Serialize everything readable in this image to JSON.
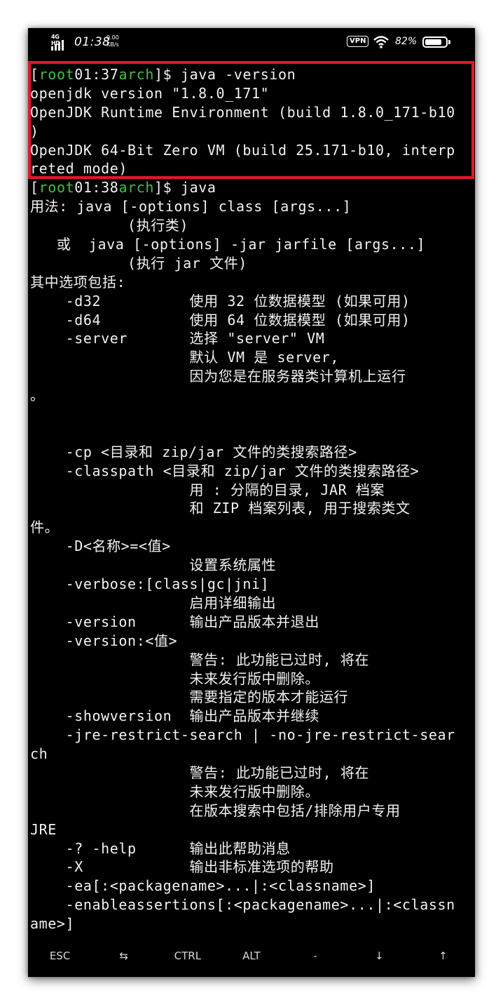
{
  "status_bar": {
    "network": "4G HD",
    "time": "01:38",
    "speed_value": "0.00",
    "speed_unit": "KB/s",
    "vpn": "VPN",
    "battery_percent": "82%",
    "battery_level": 0.82
  },
  "highlight_color": "#e01828",
  "prompt_color": "#40c040",
  "terminal_lines": [
    [
      {
        "t": "["
      },
      {
        "t": "root",
        "c": "g"
      },
      {
        "t": "01:37"
      },
      {
        "t": "arch",
        "c": "g"
      },
      {
        "t": "]$ java -version"
      }
    ],
    [
      {
        "t": "openjdk version \"1.8.0_171\""
      }
    ],
    [
      {
        "t": "OpenJDK Runtime Environment (build 1.8.0_171-b10"
      }
    ],
    [
      {
        "t": ")"
      }
    ],
    [
      {
        "t": "OpenJDK 64-Bit Zero VM (build 25.171-b10, interp"
      }
    ],
    [
      {
        "t": "reted mode)"
      }
    ],
    [
      {
        "t": "["
      },
      {
        "t": "root",
        "c": "g"
      },
      {
        "t": "01:38"
      },
      {
        "t": "arch",
        "c": "g"
      },
      {
        "t": "]$ java"
      }
    ],
    [
      {
        "t": "用法: java [-options] class [args...]"
      }
    ],
    [
      {
        "t": "           (执行类)"
      }
    ],
    [
      {
        "t": "   或  java [-options] -jar jarfile [args...]"
      }
    ],
    [
      {
        "t": "           (执行 jar 文件)"
      }
    ],
    [
      {
        "t": "其中选项包括:"
      }
    ],
    [
      {
        "t": "    -d32          使用 32 位数据模型 (如果可用)"
      }
    ],
    [
      {
        "t": "    -d64          使用 64 位数据模型 (如果可用)"
      }
    ],
    [
      {
        "t": "    -server       选择 \"server\" VM"
      }
    ],
    [
      {
        "t": "                  默认 VM 是 server,"
      }
    ],
    [
      {
        "t": "                  因为您是在服务器类计算机上运行"
      }
    ],
    [
      {
        "t": "。"
      }
    ],
    [
      {
        "t": ""
      }
    ],
    [
      {
        "t": ""
      }
    ],
    [
      {
        "t": "    -cp <目录和 zip/jar 文件的类搜索路径>"
      }
    ],
    [
      {
        "t": "    -classpath <目录和 zip/jar 文件的类搜索路径>"
      }
    ],
    [
      {
        "t": "                  用 : 分隔的目录, JAR 档案"
      }
    ],
    [
      {
        "t": "                  和 ZIP 档案列表, 用于搜索类文"
      }
    ],
    [
      {
        "t": "件。"
      }
    ],
    [
      {
        "t": "    -D<名称>=<值>"
      }
    ],
    [
      {
        "t": "                  设置系统属性"
      }
    ],
    [
      {
        "t": "    -verbose:[class|gc|jni]"
      }
    ],
    [
      {
        "t": "                  启用详细输出"
      }
    ],
    [
      {
        "t": "    -version      输出产品版本并退出"
      }
    ],
    [
      {
        "t": "    -version:<值>"
      }
    ],
    [
      {
        "t": "                  警告: 此功能已过时, 将在"
      }
    ],
    [
      {
        "t": "                  未来发行版中删除。"
      }
    ],
    [
      {
        "t": "                  需要指定的版本才能运行"
      }
    ],
    [
      {
        "t": "    -showversion  输出产品版本并继续"
      }
    ],
    [
      {
        "t": "    -jre-restrict-search | -no-jre-restrict-sear"
      }
    ],
    [
      {
        "t": "ch"
      }
    ],
    [
      {
        "t": "                  警告: 此功能已过时, 将在"
      }
    ],
    [
      {
        "t": "                  未来发行版中删除。"
      }
    ],
    [
      {
        "t": "                  在版本搜索中包括/排除用户专用"
      }
    ],
    [
      {
        "t": "JRE"
      }
    ],
    [
      {
        "t": "    -? -help      输出此帮助消息"
      }
    ],
    [
      {
        "t": "    -X            输出非标准选项的帮助"
      }
    ],
    [
      {
        "t": "    -ea[:<packagename>...|:<classname>]"
      }
    ],
    [
      {
        "t": "    -enableassertions[:<packagename>...|:<classn"
      }
    ],
    [
      {
        "t": "ame>]"
      }
    ]
  ],
  "extra_keys": [
    {
      "label": "ESC",
      "icon": "esc-key"
    },
    {
      "label": "⇆",
      "icon": "tab-icon"
    },
    {
      "label": "CTRL",
      "icon": "ctrl-key"
    },
    {
      "label": "ALT",
      "icon": "alt-key"
    },
    {
      "label": "-",
      "icon": "dash-key"
    },
    {
      "label": "↓",
      "icon": "arrow-down-icon"
    },
    {
      "label": "↑",
      "icon": "arrow-up-icon"
    }
  ]
}
